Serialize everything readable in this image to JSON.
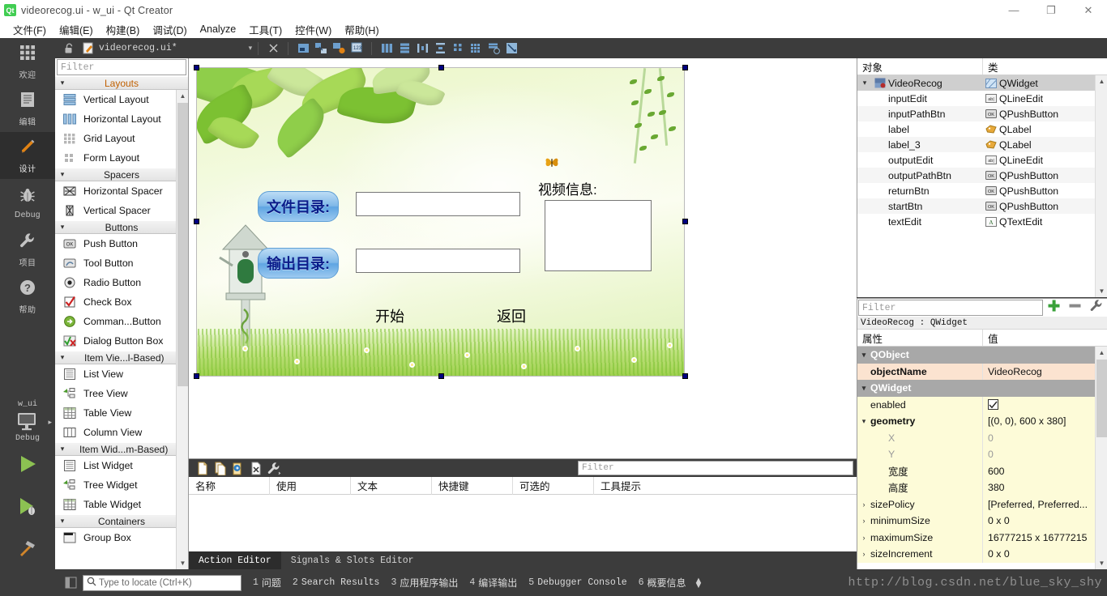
{
  "window": {
    "title": "videorecog.ui - w_ui - Qt Creator",
    "logo_text": "Qt",
    "minimize": "—",
    "restore": "❐",
    "close": "✕"
  },
  "menubar": {
    "items": [
      {
        "label": "文件(F)"
      },
      {
        "label": "编辑(E)"
      },
      {
        "label": "构建(B)"
      },
      {
        "label": "调试(D)"
      },
      {
        "label": "Analyze"
      },
      {
        "label": "工具(T)"
      },
      {
        "label": "控件(W)"
      },
      {
        "label": "帮助(H)"
      }
    ]
  },
  "editor_toolbar": {
    "filename": "videorecog.ui*",
    "dropdown_caret": "▾",
    "close_label": "✕",
    "icons": [
      {
        "name": "edit-widgets-icon"
      },
      {
        "name": "edit-signals-slots-icon"
      },
      {
        "name": "edit-buddies-icon"
      },
      {
        "name": "edit-tab-order-icon"
      },
      {
        "name": "layout-horizontally-icon"
      },
      {
        "name": "layout-vertically-icon"
      },
      {
        "name": "layout-splitter-horizontal-icon"
      },
      {
        "name": "layout-splitter-vertical-icon"
      },
      {
        "name": "layout-form-icon"
      },
      {
        "name": "layout-grid-icon"
      },
      {
        "name": "break-layout-icon"
      },
      {
        "name": "adjust-size-icon"
      }
    ]
  },
  "modebar": {
    "items": [
      {
        "label": "欢迎",
        "icon": "welcome-icon",
        "active": false
      },
      {
        "label": "编辑",
        "icon": "edit-icon",
        "active": false
      },
      {
        "label": "设计",
        "icon": "design-pencil-icon",
        "active": true
      },
      {
        "label": "Debug",
        "icon": "debug-bug-icon",
        "active": false
      },
      {
        "label": "项目",
        "icon": "projects-wrench-icon",
        "active": false
      },
      {
        "label": "帮助",
        "icon": "help-question-icon",
        "active": false
      }
    ],
    "kit_name": "w_ui",
    "build_config": "Debug",
    "run_label": "run-button",
    "debug_label": "start-debugging-button",
    "build_label": "build-project-button"
  },
  "widgetbox": {
    "filter_placeholder": "Filter",
    "groups": [
      {
        "name": "Layouts",
        "highlight": true,
        "items": [
          {
            "label": "Vertical Layout",
            "icon": "vertical-layout-icon"
          },
          {
            "label": "Horizontal Layout",
            "icon": "horizontal-layout-icon"
          },
          {
            "label": "Grid Layout",
            "icon": "grid-layout-icon"
          },
          {
            "label": "Form Layout",
            "icon": "form-layout-icon"
          }
        ]
      },
      {
        "name": "Spacers",
        "highlight": false,
        "items": [
          {
            "label": "Horizontal Spacer",
            "icon": "horizontal-spacer-icon"
          },
          {
            "label": "Vertical Spacer",
            "icon": "vertical-spacer-icon"
          }
        ]
      },
      {
        "name": "Buttons",
        "highlight": false,
        "items": [
          {
            "label": "Push Button",
            "icon": "push-button-icon"
          },
          {
            "label": "Tool Button",
            "icon": "tool-button-icon"
          },
          {
            "label": "Radio Button",
            "icon": "radio-button-icon"
          },
          {
            "label": "Check Box",
            "icon": "check-box-icon"
          },
          {
            "label": "Comman...Button",
            "icon": "command-link-button-icon"
          },
          {
            "label": "Dialog Button Box",
            "icon": "dialog-button-box-icon"
          }
        ]
      },
      {
        "name": "Item Vie...l-Based)",
        "highlight": false,
        "items": [
          {
            "label": "List View",
            "icon": "list-view-icon"
          },
          {
            "label": "Tree View",
            "icon": "tree-view-icon"
          },
          {
            "label": "Table View",
            "icon": "table-view-icon"
          },
          {
            "label": "Column View",
            "icon": "column-view-icon"
          }
        ]
      },
      {
        "name": "Item Wid...m-Based)",
        "highlight": false,
        "items": [
          {
            "label": "List Widget",
            "icon": "list-widget-icon"
          },
          {
            "label": "Tree Widget",
            "icon": "tree-widget-icon"
          },
          {
            "label": "Table Widget",
            "icon": "table-widget-icon"
          }
        ]
      },
      {
        "name": "Containers",
        "highlight": false,
        "items": [
          {
            "label": "Group Box",
            "icon": "group-box-icon"
          }
        ]
      }
    ]
  },
  "form": {
    "file_label": "文件目录:",
    "output_label": "输出目录:",
    "video_info_label": "视频信息:",
    "start_button": "开始",
    "return_button": "返回",
    "input_value": "",
    "output_value": "",
    "textedit_value": "",
    "blue_button_color": "#6fb0e5",
    "blue_text_color": "#0b1c8a"
  },
  "action_editor": {
    "filter_placeholder": "Filter",
    "toolbar_icons": [
      {
        "name": "new-action-icon"
      },
      {
        "name": "copy-action-icon"
      },
      {
        "name": "paste-action-icon"
      },
      {
        "name": "delete-action-icon"
      },
      {
        "name": "configure-icon"
      }
    ],
    "columns": [
      "名称",
      "使用",
      "文本",
      "快捷键",
      "可选的",
      "工具提示"
    ],
    "rows": [],
    "tabs": [
      {
        "label": "Action Editor",
        "active": true
      },
      {
        "label": "Signals & Slots Editor",
        "active": false
      }
    ]
  },
  "object_inspector": {
    "columns": [
      "对象",
      "类"
    ],
    "rows": [
      {
        "name": "VideoRecog",
        "class": "QWidget",
        "icon": "widget-icon",
        "indent": 0,
        "expanded": true,
        "selected": true
      },
      {
        "name": "inputEdit",
        "class": "QLineEdit",
        "icon": "lineedit-icon",
        "indent": 1,
        "selected": false
      },
      {
        "name": "inputPathBtn",
        "class": "QPushButton",
        "icon": "pushbutton-icon",
        "indent": 1,
        "selected": false
      },
      {
        "name": "label",
        "class": "QLabel",
        "icon": "label-icon",
        "indent": 1,
        "selected": false
      },
      {
        "name": "label_3",
        "class": "QLabel",
        "icon": "label-icon",
        "indent": 1,
        "selected": false
      },
      {
        "name": "outputEdit",
        "class": "QLineEdit",
        "icon": "lineedit-icon",
        "indent": 1,
        "selected": false
      },
      {
        "name": "outputPathBtn",
        "class": "QPushButton",
        "icon": "pushbutton-icon",
        "indent": 1,
        "selected": false
      },
      {
        "name": "returnBtn",
        "class": "QPushButton",
        "icon": "pushbutton-icon",
        "indent": 1,
        "selected": false
      },
      {
        "name": "startBtn",
        "class": "QPushButton",
        "icon": "pushbutton-icon",
        "indent": 1,
        "selected": false
      },
      {
        "name": "textEdit",
        "class": "QTextEdit",
        "icon": "textedit-icon",
        "indent": 1,
        "selected": false
      }
    ]
  },
  "property_editor": {
    "filter_placeholder": "Filter",
    "add_button": "+",
    "remove_button": "−",
    "configure_button": "configure-icon",
    "object_line": "VideoRecog : QWidget",
    "columns": [
      "属性",
      "值"
    ],
    "rows": [
      {
        "kind": "group",
        "label": "QObject",
        "value": "",
        "twisty": "⌄"
      },
      {
        "kind": "tan",
        "label": "objectName",
        "value": "VideoRecog",
        "bold": true,
        "indent": 1
      },
      {
        "kind": "group",
        "label": "QWidget",
        "value": "",
        "twisty": "⌄"
      },
      {
        "kind": "yel",
        "label": "enabled",
        "value": "",
        "checkbox": true,
        "indent": 1
      },
      {
        "kind": "yel",
        "label": "geometry",
        "value": "[(0, 0), 600 x 380]",
        "bold": true,
        "twisty": "⌄",
        "indent": 0
      },
      {
        "kind": "yel",
        "label": "X",
        "value": "0",
        "gray": true,
        "indent": 2
      },
      {
        "kind": "yel",
        "label": "Y",
        "value": "0",
        "gray": true,
        "indent": 2
      },
      {
        "kind": "yel",
        "label": "宽度",
        "value": "600",
        "indent": 2
      },
      {
        "kind": "yel",
        "label": "高度",
        "value": "380",
        "indent": 2
      },
      {
        "kind": "yel",
        "label": "sizePolicy",
        "value": "[Preferred, Preferred...",
        "twisty": "›",
        "indent": 0
      },
      {
        "kind": "yel",
        "label": "minimumSize",
        "value": "0 x 0",
        "twisty": "›",
        "indent": 0
      },
      {
        "kind": "yel",
        "label": "maximumSize",
        "value": "16777215 x 16777215",
        "twisty": "›",
        "indent": 0
      },
      {
        "kind": "yel",
        "label": "sizeIncrement",
        "value": "0 x 0",
        "twisty": "›",
        "indent": 0
      }
    ]
  },
  "statusbar": {
    "locator_placeholder": "Type to locate (Ctrl+K)",
    "items": [
      {
        "num": "1",
        "text": "问题",
        "mono": false
      },
      {
        "num": "2",
        "text": "Search Results",
        "mono": true
      },
      {
        "num": "3",
        "text": "应用程序输出",
        "mono": false
      },
      {
        "num": "4",
        "text": "编译输出",
        "mono": false
      },
      {
        "num": "5",
        "text": "Debugger Console",
        "mono": true
      },
      {
        "num": "6",
        "text": "概要信息",
        "mono": false
      }
    ],
    "watermark": "http://blog.csdn.net/blue_sky_shy"
  }
}
